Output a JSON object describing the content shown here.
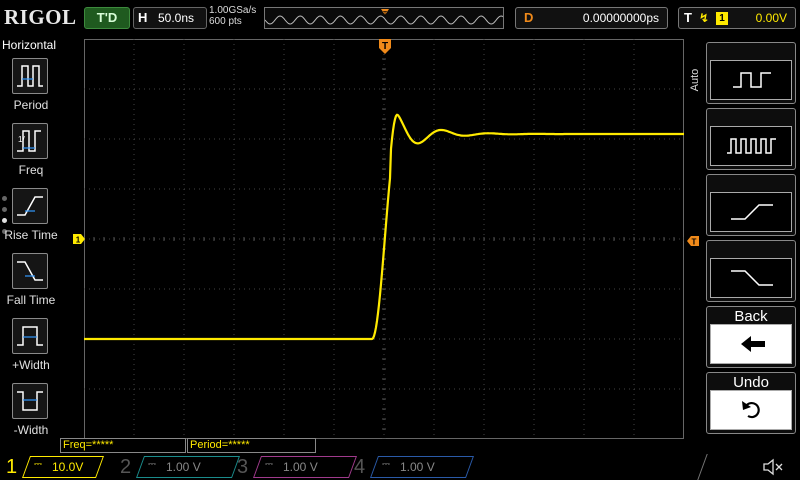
{
  "topbar": {
    "logo": "RIGOL",
    "run_state": "T'D",
    "horizontal": {
      "label": "H",
      "value": "50.0ns"
    },
    "sample_rate": "1.00GSa/s",
    "memory_depth": "600 pts",
    "delay": {
      "label": "D",
      "value": "0.00000000ps"
    },
    "trigger": {
      "label": "T",
      "edge": "↯",
      "source": "1",
      "level": "0.00V"
    }
  },
  "left_menu": {
    "title": "Horizontal",
    "items": [
      {
        "label": "Period",
        "icon": "period-icon"
      },
      {
        "label": "Freq",
        "icon": "freq-icon"
      },
      {
        "label": "Rise Time",
        "icon": "rise-time-icon"
      },
      {
        "label": "Fall Time",
        "icon": "fall-time-icon"
      },
      {
        "label": "+Width",
        "icon": "pos-width-icon"
      },
      {
        "label": "-Width",
        "icon": "neg-width-icon"
      }
    ]
  },
  "right_menu": {
    "tab": "Auto",
    "buttons": [
      {
        "name": "auto-waveform-button-1",
        "icon": "square-wave-icon",
        "label": ""
      },
      {
        "name": "auto-waveform-button-2",
        "icon": "multi-cycle-icon",
        "label": ""
      },
      {
        "name": "auto-waveform-button-3",
        "icon": "rising-edge-icon",
        "label": ""
      },
      {
        "name": "auto-waveform-button-4",
        "icon": "falling-edge-icon",
        "label": ""
      },
      {
        "name": "back-button",
        "icon": "back-arrow-icon",
        "label": "Back"
      },
      {
        "name": "undo-button",
        "icon": "undo-icon",
        "label": "Undo"
      }
    ]
  },
  "grid": {
    "markers": {
      "trigger": "T",
      "channel": "1"
    }
  },
  "measurements": [
    {
      "label": "Freq=*****"
    },
    {
      "label": "Period=*****"
    }
  ],
  "channels": [
    {
      "num": "1",
      "scale": "10.0V",
      "active": true,
      "color": "#ffea00"
    },
    {
      "num": "2",
      "scale": "1.00 V",
      "active": false,
      "color": "#1a8c8c"
    },
    {
      "num": "3",
      "scale": "1.00 V",
      "active": false,
      "color": "#a03a8c"
    },
    {
      "num": "4",
      "scale": "1.00 V",
      "active": false,
      "color": "#2a5aa8"
    }
  ],
  "colors": {
    "trace": "#ffea00",
    "trigger_marker": "#f08a1a",
    "grid": "#4a4a4a"
  }
}
